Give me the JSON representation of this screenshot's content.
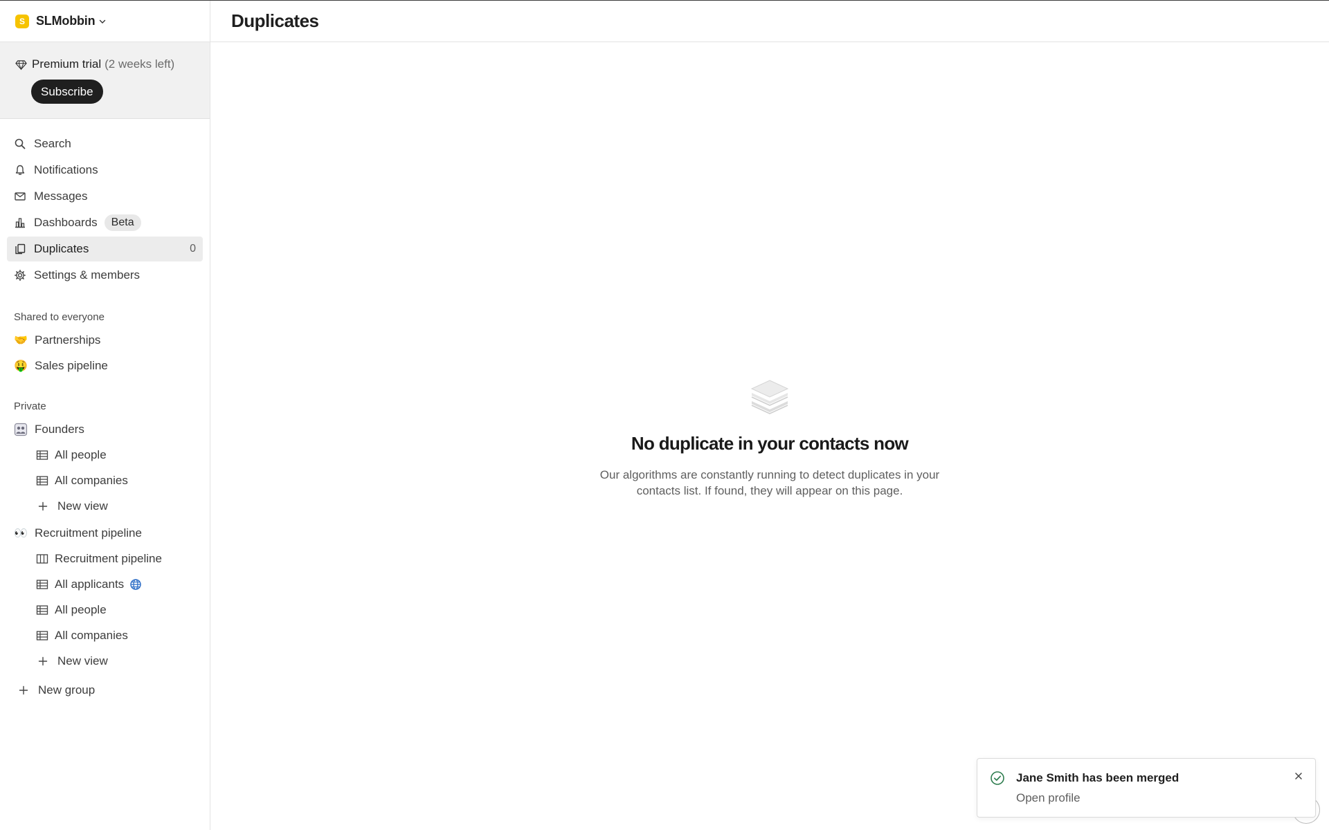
{
  "workspace": {
    "initial": "S",
    "name": "SLMobbin",
    "logo_color": "#f6c300"
  },
  "trial": {
    "label": "Premium trial",
    "remaining": "(2 weeks left)",
    "subscribe_label": "Subscribe"
  },
  "nav": {
    "search": "Search",
    "notifications": "Notifications",
    "messages": "Messages",
    "dashboards": "Dashboards",
    "dashboards_badge": "Beta",
    "duplicates": "Duplicates",
    "duplicates_count": "0",
    "settings": "Settings & members"
  },
  "shared": {
    "title": "Shared to everyone",
    "items": [
      {
        "emoji": "🤝",
        "label": "Partnerships"
      },
      {
        "emoji": "🤑",
        "label": "Sales pipeline"
      }
    ]
  },
  "private": {
    "title": "Private",
    "founders": {
      "label": "Founders",
      "views": [
        "All people",
        "All companies"
      ],
      "new_view": "New view"
    },
    "recruitment": {
      "emoji": "👀",
      "label": "Recruitment pipeline",
      "views": [
        "Recruitment pipeline",
        "All applicants",
        "All people",
        "All companies"
      ],
      "new_view": "New view"
    },
    "new_group": "New group"
  },
  "main": {
    "title": "Duplicates",
    "empty_title": "No duplicate in your contacts now",
    "empty_desc": "Our algorithms are constantly running to detect duplicates in your contacts list. If found, they will appear on this page."
  },
  "toast": {
    "title": "Jane Smith has been merged",
    "link": "Open profile",
    "success_color": "#2e7d4f"
  },
  "colors": {
    "active_bg": "#ececec",
    "subscribe_bg": "#1f1f1f",
    "globe": "#2f6fc7"
  }
}
